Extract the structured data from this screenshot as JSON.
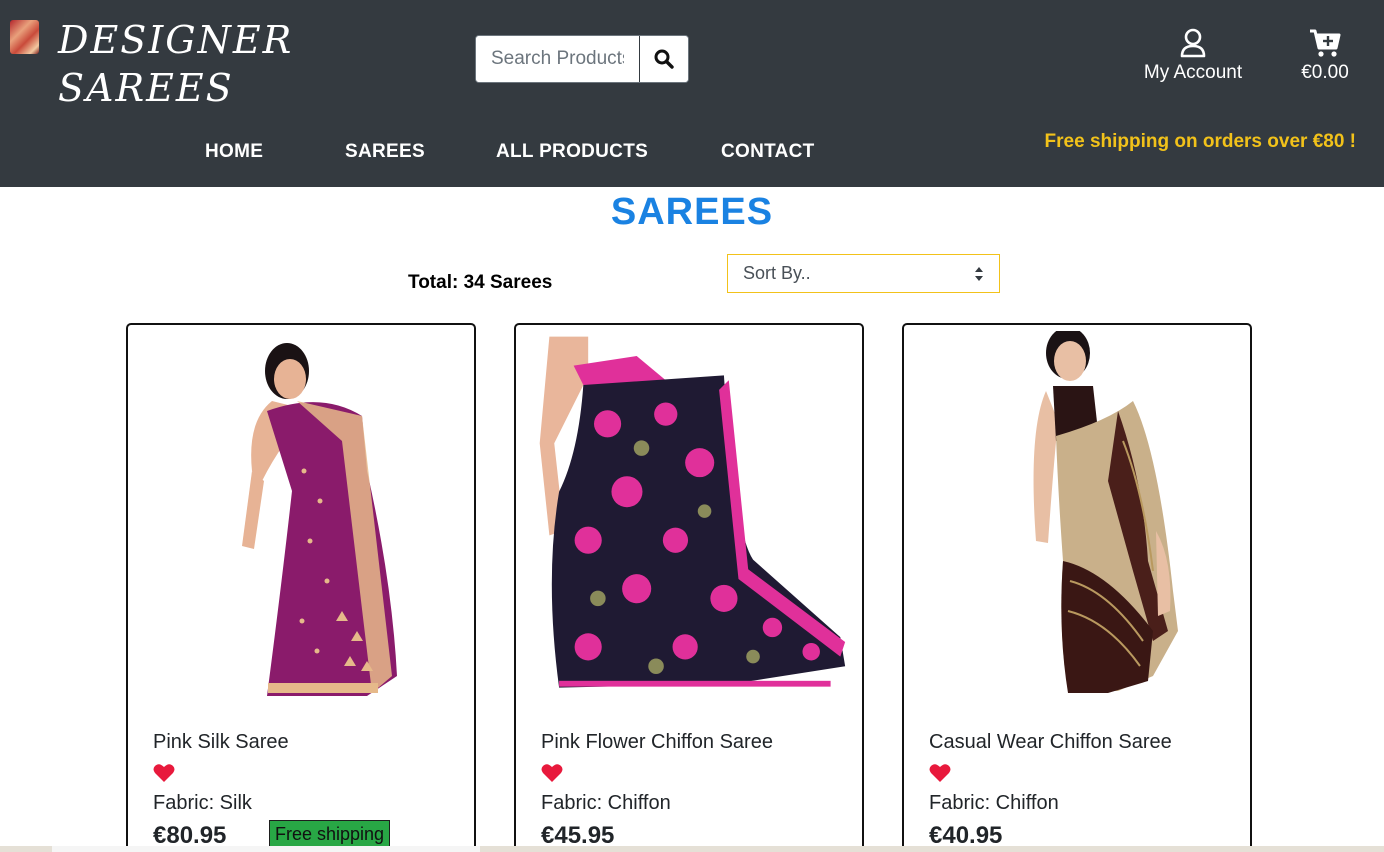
{
  "header": {
    "brand_line1": "DESIGNER",
    "brand_line2": "SAREES",
    "logo_icon": "saree-logo-image",
    "search": {
      "placeholder": "Search Products",
      "button_icon": "search-icon"
    },
    "account": {
      "label": "My Account",
      "icon": "user-icon"
    },
    "cart": {
      "label": "€0.00",
      "icon": "cart-plus-icon"
    },
    "nav": [
      {
        "label": "HOME"
      },
      {
        "label": "SAREES"
      },
      {
        "label": "ALL PRODUCTS"
      },
      {
        "label": "CONTACT"
      }
    ],
    "promo": "Free shipping on orders over €80 !"
  },
  "page": {
    "title": "SAREES",
    "total": "Total: 34 Sarees",
    "sort_label": "Sort By.."
  },
  "products": [
    {
      "name": "Pink Silk Saree",
      "fabric": "Fabric: Silk",
      "price": "€80.95",
      "badge": "Free shipping",
      "color": "#8a1b6b",
      "accent": "#e6b98a"
    },
    {
      "name": "Pink Flower Chiffon Saree",
      "fabric": "Fabric: Chiffon",
      "price": "€45.95",
      "badge": "",
      "color": "#1f1a33",
      "accent": "#e0309a"
    },
    {
      "name": "Casual Wear Chiffon Saree",
      "fabric": "Fabric: Chiffon",
      "price": "€40.95",
      "badge": "",
      "color": "#c9b08a",
      "accent": "#4a1f1a"
    }
  ],
  "colors": {
    "header_bg": "#343a40",
    "title_blue": "#1a82e2",
    "promo_yellow": "#f2c21a",
    "heart_red": "#e8193c",
    "badge_green": "#28a745"
  }
}
